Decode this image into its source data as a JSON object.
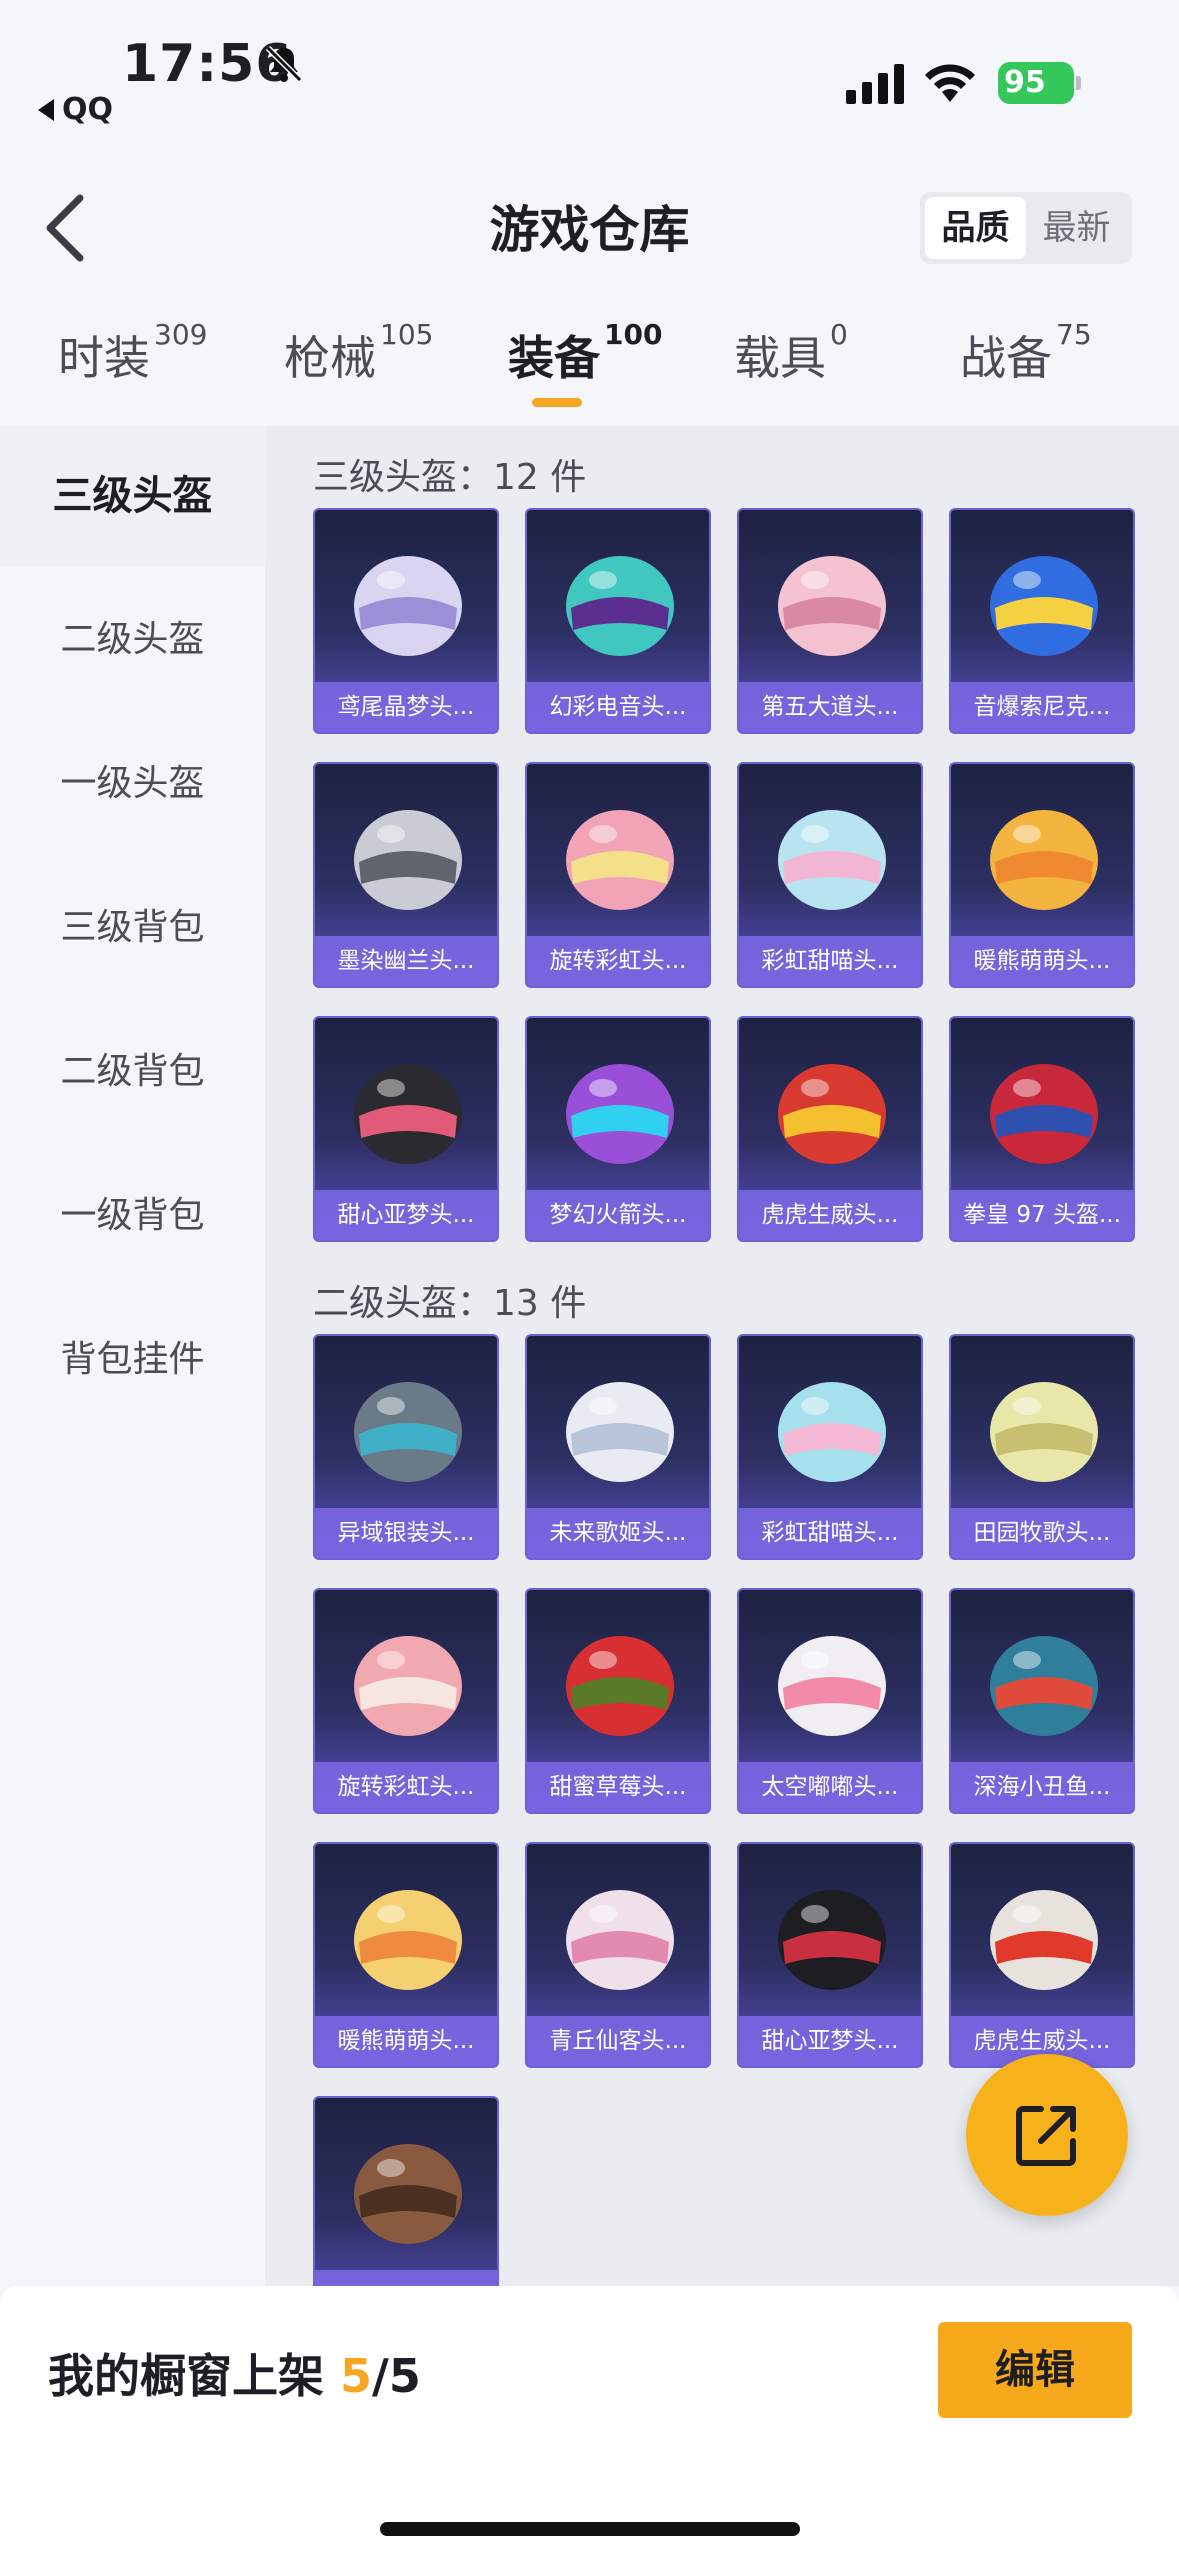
{
  "status": {
    "time": "17:56",
    "back_app": "QQ",
    "battery": "95"
  },
  "header": {
    "title": "游戏仓库",
    "sort_options": [
      "品质",
      "最新"
    ]
  },
  "tabs": [
    {
      "label": "时装",
      "count": "309"
    },
    {
      "label": "枪械",
      "count": "105"
    },
    {
      "label": "装备",
      "count": "100"
    },
    {
      "label": "载具",
      "count": "0"
    },
    {
      "label": "战备",
      "count": "75"
    }
  ],
  "sidebar": {
    "items": [
      "三级头盔",
      "二级头盔",
      "一级头盔",
      "三级背包",
      "二级背包",
      "一级背包",
      "背包挂件"
    ]
  },
  "sections": [
    {
      "title": "三级头盔：12 件",
      "items": [
        "鸢尾晶梦头...",
        "幻彩电音头...",
        "第五大道头...",
        "音爆索尼克...",
        "墨染幽兰头...",
        "旋转彩虹头...",
        "彩虹甜喵头...",
        "暖熊萌萌头...",
        "甜心亚梦头...",
        "梦幻火箭头...",
        "虎虎生威头...",
        "拳皇 97 头盔..."
      ]
    },
    {
      "title": "二级头盔：13 件",
      "items": [
        "异域银装头...",
        "未来歌姬头...",
        "彩虹甜喵头...",
        "田园牧歌头...",
        "旋转彩虹头...",
        "甜蜜草莓头...",
        "太空嘟嘟头...",
        "深海小丑鱼...",
        "暖熊萌萌头...",
        "青丘仙客头...",
        "甜心亚梦头...",
        "虎虎生威头...",
        ""
      ]
    }
  ],
  "bottom": {
    "shelf_label": "我的橱窗上架",
    "shelf_current": "5",
    "shelf_total": "/5",
    "edit_label": "编辑"
  },
  "colors": {
    "accent": "#f7a81b",
    "card_border": "#6d61d6",
    "card_label_bg": "#7c6ae6"
  }
}
